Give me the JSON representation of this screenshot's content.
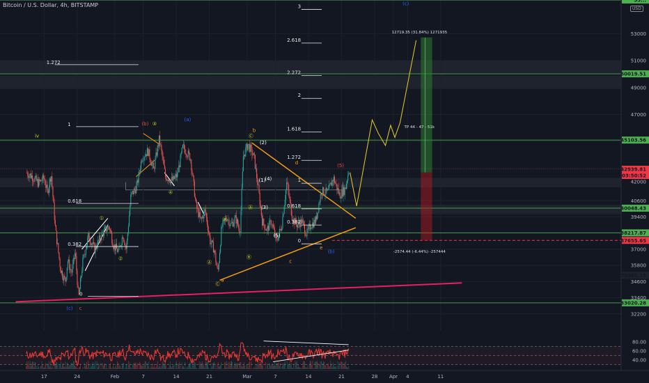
{
  "header": {
    "title": "Bitcoin / U.S. Dollar, 4h, BITSTAMP",
    "currency_badge": "USD"
  },
  "colors": {
    "background": "#131722",
    "green_level": "#4caf50",
    "up_candle": "#26a69a",
    "down_candle": "#ef5350",
    "triangle": "#f59e0b",
    "projection": "#d4c22a",
    "trendline": "#e91e63",
    "rsi": "#e53935",
    "wave_blue": "#2962ff"
  },
  "chart_data": {
    "type": "candlestick",
    "title": "Bitcoin / U.S. Dollar, 4h, BITSTAMP",
    "ylim": [
      31000,
      55500
    ],
    "y_ticks": [
      32200,
      33400,
      34600,
      35800,
      37000,
      38200,
      39400,
      40600,
      42000,
      43000,
      45000,
      47000,
      49000,
      51000,
      53000
    ],
    "x_ticks": [
      {
        "label": "17",
        "day": -15
      },
      {
        "label": "24",
        "day": -8
      },
      {
        "label": "Feb",
        "day": 0
      },
      {
        "label": "7",
        "day": 6
      },
      {
        "label": "14",
        "day": 13
      },
      {
        "label": "21",
        "day": 20
      },
      {
        "label": "Mar",
        "day": 28
      },
      {
        "label": "7",
        "day": 34
      },
      {
        "label": "14",
        "day": 41
      },
      {
        "label": "21",
        "day": 48
      },
      {
        "label": "28",
        "day": 55
      },
      {
        "label": "Apr",
        "day": 59
      },
      {
        "label": "4",
        "day": 62
      },
      {
        "label": "11",
        "day": 69
      }
    ],
    "price_path": [
      {
        "day": -18.8,
        "price": 42700
      },
      {
        "day": -17.5,
        "price": 42400
      },
      {
        "day": -16.2,
        "price": 41900
      },
      {
        "day": -15,
        "price": 42300
      },
      {
        "day": -14.3,
        "price": 41200
      },
      {
        "day": -13.5,
        "price": 42600
      },
      {
        "day": -12.6,
        "price": 38500
      },
      {
        "day": -11.5,
        "price": 35500
      },
      {
        "day": -10.5,
        "price": 34600
      },
      {
        "day": -10,
        "price": 36200
      },
      {
        "day": -9.2,
        "price": 35200
      },
      {
        "day": -8.4,
        "price": 36800
      },
      {
        "day": -7.7,
        "price": 33300
      },
      {
        "day": -6.8,
        "price": 36100
      },
      {
        "day": -5.6,
        "price": 38000
      },
      {
        "day": -4.3,
        "price": 37000
      },
      {
        "day": -2.6,
        "price": 38200
      },
      {
        "day": -1.2,
        "price": 38700
      },
      {
        "day": -0.3,
        "price": 37300
      },
      {
        "day": 0.8,
        "price": 36800
      },
      {
        "day": 1.7,
        "price": 38100
      },
      {
        "day": 2.4,
        "price": 37000
      },
      {
        "day": 3.4,
        "price": 41000
      },
      {
        "day": 4.6,
        "price": 41600
      },
      {
        "day": 5.7,
        "price": 43800
      },
      {
        "day": 7,
        "price": 44300
      },
      {
        "day": 8.2,
        "price": 42900
      },
      {
        "day": 9.4,
        "price": 45200
      },
      {
        "day": 10.7,
        "price": 42400
      },
      {
        "day": 12.2,
        "price": 42100
      },
      {
        "day": 13.2,
        "price": 42500
      },
      {
        "day": 14.4,
        "price": 44600
      },
      {
        "day": 16,
        "price": 43800
      },
      {
        "day": 17.2,
        "price": 40200
      },
      {
        "day": 18.2,
        "price": 39100
      },
      {
        "day": 19.1,
        "price": 39900
      },
      {
        "day": 20.2,
        "price": 37600
      },
      {
        "day": 21,
        "price": 37000
      },
      {
        "day": 21.8,
        "price": 35200
      },
      {
        "day": 22.6,
        "price": 38600
      },
      {
        "day": 23.7,
        "price": 39400
      },
      {
        "day": 24.6,
        "price": 38800
      },
      {
        "day": 25.6,
        "price": 39300
      },
      {
        "day": 26.5,
        "price": 38300
      },
      {
        "day": 27.2,
        "price": 43900
      },
      {
        "day": 28.2,
        "price": 44800
      },
      {
        "day": 29.5,
        "price": 43800
      },
      {
        "day": 30.4,
        "price": 41400
      },
      {
        "day": 31.2,
        "price": 39100
      },
      {
        "day": 32.2,
        "price": 38400
      },
      {
        "day": 33.1,
        "price": 39100
      },
      {
        "day": 34.2,
        "price": 37600
      },
      {
        "day": 35.3,
        "price": 38700
      },
      {
        "day": 36.4,
        "price": 42000
      },
      {
        "day": 37.6,
        "price": 39300
      },
      {
        "day": 38.6,
        "price": 38800
      },
      {
        "day": 39.6,
        "price": 39100
      },
      {
        "day": 40.6,
        "price": 38100
      },
      {
        "day": 41.5,
        "price": 38800
      },
      {
        "day": 42.5,
        "price": 39100
      },
      {
        "day": 43.7,
        "price": 41300
      },
      {
        "day": 45.1,
        "price": 41200
      },
      {
        "day": 46.3,
        "price": 42300
      },
      {
        "day": 47.6,
        "price": 41000
      },
      {
        "day": 48.8,
        "price": 41500
      },
      {
        "day": 49.6,
        "price": 43000
      }
    ],
    "horizontal_levels": [
      {
        "price": 55500,
        "label": "55..."
      },
      {
        "price": 50019.51,
        "label": "50019.51"
      },
      {
        "price": 45103.56,
        "label": "45103.56"
      },
      {
        "price": 40048.43,
        "label": "40048.43"
      },
      {
        "price": 38217.87,
        "label": "38217.87"
      },
      {
        "price": 33020.28,
        "label": "33020.28"
      }
    ],
    "price_markers": [
      {
        "price": 42939.81,
        "label": "42939.81",
        "sub": "03:50:52",
        "color": "#f23645"
      },
      {
        "price": 37655.65,
        "label": "37655.65",
        "color": "#f23645"
      },
      {
        "price": 35065.13,
        "label": "35065.13",
        "color": "#1e222d"
      }
    ],
    "fib_left": [
      {
        "label": "1.272",
        "price": 50700,
        "d1": -14.5,
        "d2": 5
      },
      {
        "label": "1",
        "price": 46100,
        "d1": -10,
        "d2": 5
      },
      {
        "label": "0.618",
        "price": 40400,
        "d1": -10,
        "d2": 5
      },
      {
        "label": "0.382",
        "price": 37200,
        "d1": -10,
        "d2": 5
      },
      {
        "label": "0",
        "price": 33500,
        "d1": -7.5,
        "d2": 5
      }
    ],
    "fib_right": [
      {
        "label": "3",
        "price": 54800
      },
      {
        "label": "2.618",
        "price": 52300
      },
      {
        "label": "2.272",
        "price": 49900
      },
      {
        "label": "2",
        "price": 48200
      },
      {
        "label": "1.618",
        "price": 45700
      },
      {
        "label": "1.272",
        "price": 43600
      },
      {
        "label": "1",
        "price": 41900
      },
      {
        "label": "0.618",
        "price": 40000
      },
      {
        "label": "0.382",
        "price": 38800
      },
      {
        "label": "0",
        "price": 37400
      }
    ],
    "wave_labels": [
      {
        "text": "iv",
        "day": -16.5,
        "price": 45300,
        "color": "#c8d11a"
      },
      {
        "text": "①",
        "day": -2.8,
        "price": 39200,
        "color": "#c8d11a"
      },
      {
        "text": "②",
        "day": 1.2,
        "price": 36200,
        "color": "#c8d11a"
      },
      {
        "text": "(b)",
        "day": 6.4,
        "price": 46200,
        "color": "#e74c3c"
      },
      {
        "text": "③",
        "day": 8.4,
        "price": 46200,
        "color": "#c8d11a"
      },
      {
        "text": "(a)",
        "day": 15.4,
        "price": 46500,
        "color": "#2962ff"
      },
      {
        "text": "④",
        "day": 11.8,
        "price": 41100,
        "color": "#c8d11a"
      },
      {
        "text": "Ⓐ",
        "day": 20,
        "price": 35900,
        "color": "#c8d11a"
      },
      {
        "text": "Ⓑ",
        "day": 23.3,
        "price": 39100,
        "color": "#c8d11a"
      },
      {
        "text": "Ⓐ",
        "day": 28.7,
        "price": 40000,
        "color": "#c8d11a"
      },
      {
        "text": "Ⓑ",
        "day": 28.4,
        "price": 36300,
        "color": "#c8d11a"
      },
      {
        "text": "Ⓒ",
        "day": 21.8,
        "price": 34300,
        "color": "#c8d11a"
      },
      {
        "text": "a",
        "day": 22.8,
        "price": 34600,
        "color": "#f59e0b"
      },
      {
        "text": "b",
        "day": 29.5,
        "price": 45700,
        "color": "#f59e0b"
      },
      {
        "text": "Ⓒ",
        "day": 28.8,
        "price": 45300,
        "color": "#c8d11a"
      },
      {
        "text": "c",
        "day": 37.2,
        "price": 36000,
        "color": "#f59e0b"
      },
      {
        "text": "d",
        "day": 38.5,
        "price": 43300,
        "color": "#f59e0b"
      },
      {
        "text": "e",
        "day": 43.7,
        "price": 37000,
        "color": "#f59e0b"
      },
      {
        "text": "(b)",
        "day": 45.8,
        "price": 36700,
        "color": "#2962ff"
      },
      {
        "text": "(c)",
        "day": 61.6,
        "price": 55100,
        "color": "#2962ff"
      },
      {
        "text": "(c)",
        "day": -9.6,
        "price": 32500,
        "color": "#2962ff"
      },
      {
        "text": "c",
        "day": -7.3,
        "price": 32500,
        "color": "#e74c3c"
      },
      {
        "text": "(1)",
        "day": 31.2,
        "price": 42000,
        "color": "#ffffff"
      },
      {
        "text": "(2)",
        "day": 31.4,
        "price": 44800,
        "color": "#ffffff"
      },
      {
        "text": "(3)",
        "day": 31.7,
        "price": 40000,
        "color": "#ffffff"
      },
      {
        "text": "(4)",
        "day": 32.5,
        "price": 42100,
        "color": "#ffffff"
      },
      {
        "text": "(5)",
        "day": 34.3,
        "price": 37900,
        "color": "#ffffff"
      },
      {
        "text": "(5)",
        "day": 47.8,
        "price": 43100,
        "color": "#e74c3c"
      }
    ],
    "triangle": {
      "upper": [
        [
          29,
          44900
        ],
        [
          51,
          39300
        ]
      ],
      "lower": [
        [
          22.2,
          34700
        ],
        [
          51,
          38600
        ]
      ]
    },
    "trendline": [
      [
        -21,
        33100
      ],
      [
        73.5,
        34500
      ]
    ],
    "projection_path": [
      [
        49.8,
        42700
      ],
      [
        51.2,
        40200
      ],
      [
        54.5,
        46600
      ],
      [
        55.8,
        45600
      ],
      [
        57.3,
        44700
      ],
      [
        58.4,
        46200
      ],
      [
        59.3,
        45300
      ],
      [
        60.4,
        46400
      ],
      [
        63.8,
        52500
      ]
    ],
    "target_box": {
      "d1": 64.8,
      "d2": 67.2,
      "entry": 42700,
      "target": 52719.35,
      "stop": 37655.65,
      "target_note": "12719.35 (31.84%) 1271935",
      "tp_note": "TP 44 - 47 - 51k",
      "stop_note": "-2574.44 (-6.44%) -257444"
    },
    "rsi": {
      "ylim": [
        20,
        100
      ],
      "y_ticks": [
        80,
        60,
        40
      ],
      "bands": [
        70,
        50,
        30
      ]
    }
  }
}
